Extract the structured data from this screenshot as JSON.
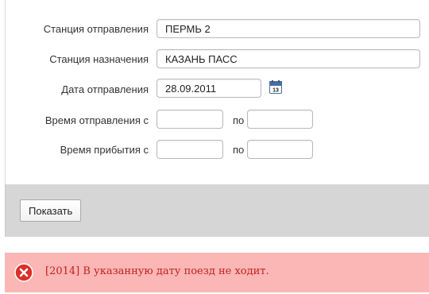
{
  "form": {
    "departure_station": {
      "label": "Станция отправления",
      "value": "ПЕРМЬ 2"
    },
    "arrival_station": {
      "label": "Станция назначения",
      "value": "КАЗАНЬ ПАСС"
    },
    "departure_date": {
      "label": "Дата отправления",
      "value": "28.09.2011"
    },
    "calendar": {
      "icon": "calendar-icon",
      "day": "13"
    },
    "departure_time": {
      "label": "Время отправления с",
      "from": "",
      "to_label": "по",
      "to": ""
    },
    "arrival_time": {
      "label": "Время прибытия с",
      "from": "",
      "to_label": "по",
      "to": ""
    }
  },
  "actions": {
    "show_label": "Показать"
  },
  "error": {
    "icon": "error-icon",
    "message": "[2014] В указанную дату поезд не ходит.",
    "text_color": "#c0221c",
    "background": "#fbb6b6"
  }
}
